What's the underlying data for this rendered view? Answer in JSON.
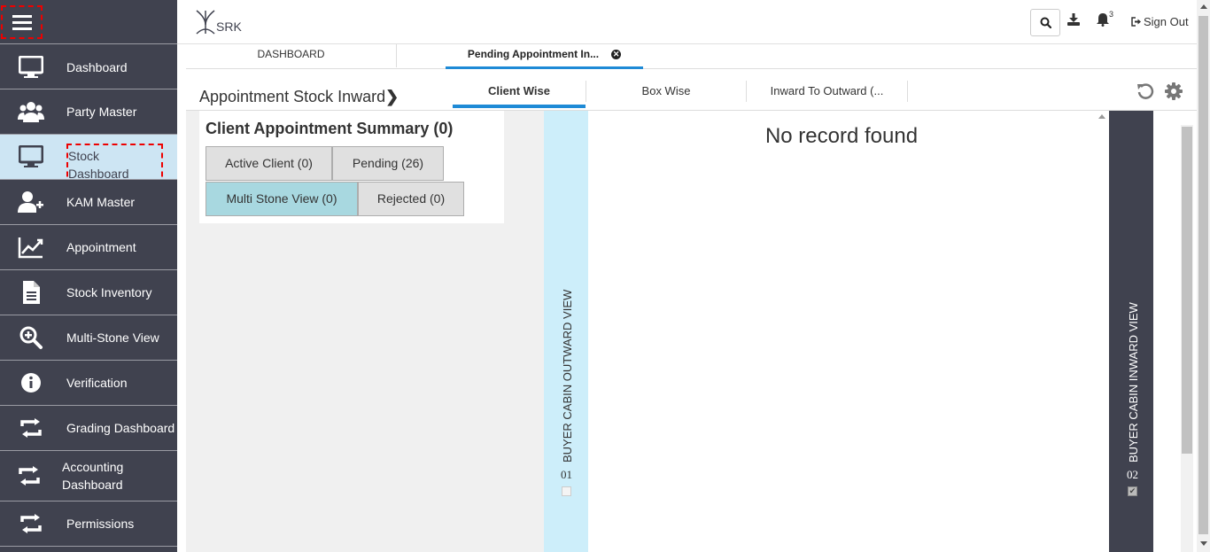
{
  "header": {
    "logo_text": "SRK",
    "bell_count": "3",
    "signout_label": "Sign Out"
  },
  "sidebar": {
    "items": [
      {
        "label": "Dashboard",
        "icon": "monitor-icon"
      },
      {
        "label": "Party Master",
        "icon": "users-icon"
      },
      {
        "label": "Stock Dashboard",
        "icon": "monitor-icon"
      },
      {
        "label": "KAM Master",
        "icon": "user-plus-icon"
      },
      {
        "label": "Appointment",
        "icon": "line-chart-icon"
      },
      {
        "label": "Stock Inventory",
        "icon": "file-icon"
      },
      {
        "label": "Multi-Stone View",
        "icon": "zoom-in-icon"
      },
      {
        "label": "Verification",
        "icon": "info-icon"
      },
      {
        "label": "Grading Dashboard",
        "icon": "retweet-icon"
      },
      {
        "label": "Accounting Dashboard",
        "label_line1": "Accounting",
        "label_line2": "Dashboard",
        "icon": "retweet-icon"
      },
      {
        "label": "Permissions",
        "icon": "retweet-icon"
      }
    ],
    "active_index": 2
  },
  "tabs": {
    "dashboard": "DASHBOARD",
    "pending": "Pending Appointment In..."
  },
  "page": {
    "title": "Appointment Stock Inward",
    "subtabs": [
      "Client Wise",
      "Box Wise",
      "Inward To Outward (..."
    ],
    "active_subtab": 0
  },
  "summary": {
    "title": "Client Appointment Summary (0)",
    "buttons": {
      "active_client": "Active Client (0)",
      "pending": "Pending (26)",
      "multi_stone": "Multi Stone View (0)",
      "rejected": "Rejected (0)"
    }
  },
  "panels": {
    "outward_label": "BUYER CABIN OUTWARD VIEW",
    "outward_number": "01",
    "inward_label": "BUYER CABIN INWARD VIEW",
    "inward_number": "02",
    "no_record": "No record found"
  },
  "colors": {
    "sidebar_bg": "#40424f",
    "sidebar_active": "#cde5f3",
    "accent": "#1e8ad6",
    "outward_strip": "#cdeefa",
    "multi_stone_btn": "#a8d8e0"
  }
}
